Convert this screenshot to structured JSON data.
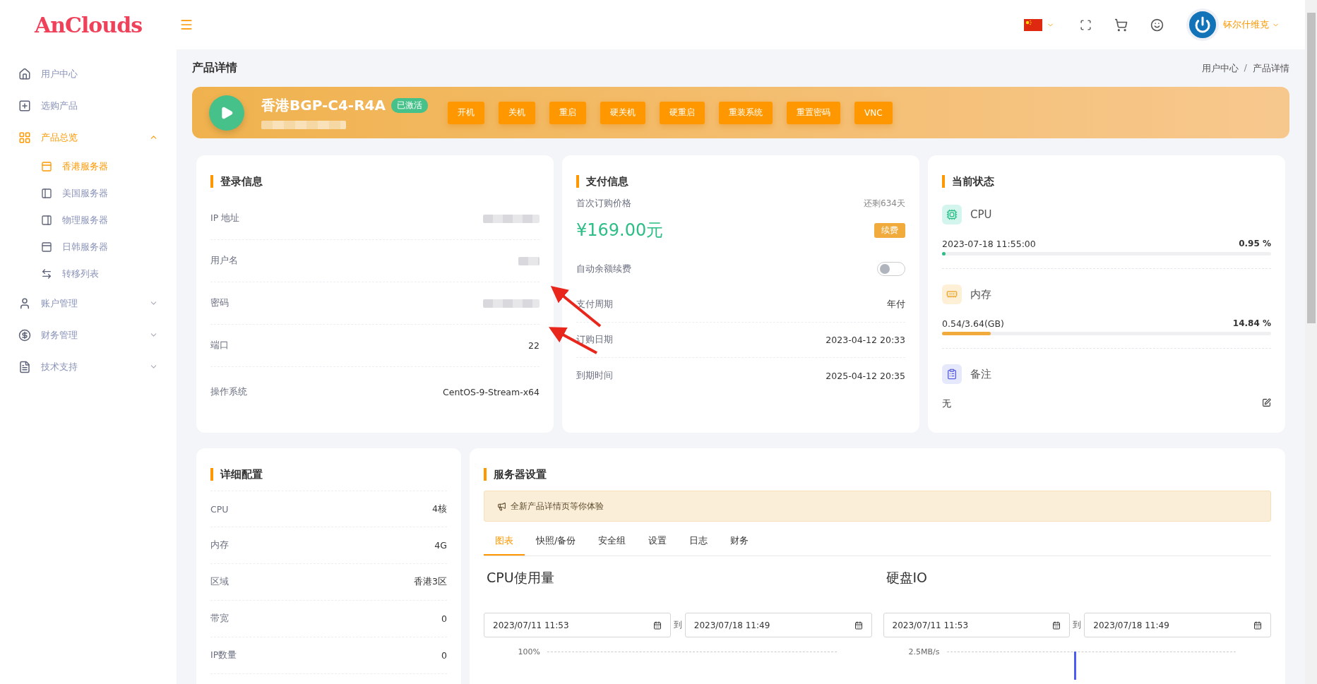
{
  "header": {
    "logo": "AnClouds",
    "user": "钚尔什维克"
  },
  "sidebar": {
    "items": [
      {
        "label": "用户中心",
        "selected": false
      },
      {
        "label": "选购产品",
        "selected": false
      },
      {
        "label": "产品总览",
        "selected": true,
        "expanded": true,
        "children": [
          {
            "label": "香港服务器",
            "selected": true
          },
          {
            "label": "美国服务器",
            "selected": false
          },
          {
            "label": "物理服务器",
            "selected": false
          },
          {
            "label": "日韩服务器",
            "selected": false
          },
          {
            "label": "转移列表",
            "selected": false
          }
        ]
      },
      {
        "label": "账户管理",
        "selected": false,
        "expanded": false
      },
      {
        "label": "财务管理",
        "selected": false,
        "expanded": false
      },
      {
        "label": "技术支持",
        "selected": false,
        "expanded": false
      }
    ]
  },
  "page": {
    "title": "产品详情",
    "breadcrumb": [
      "用户中心",
      "产品详情"
    ],
    "breadcrumb_separator": "/"
  },
  "banner": {
    "name": "香港BGP-C4-R4A",
    "status": "已激活",
    "actions": [
      "开机",
      "关机",
      "重启",
      "硬关机",
      "硬重启",
      "重装系统",
      "重置密码",
      "VNC"
    ]
  },
  "login_info": {
    "title": "登录信息",
    "rows": [
      {
        "label": "IP 地址",
        "kind": "redacted"
      },
      {
        "label": "用户名",
        "kind": "redacted"
      },
      {
        "label": "密码",
        "kind": "redacted"
      },
      {
        "label": "端口",
        "kind": "text",
        "value": "22"
      },
      {
        "label": "操作系统",
        "kind": "text",
        "value": "CentOS-9-Stream-x64"
      }
    ]
  },
  "payment": {
    "title": "支付信息",
    "price_label": "首次订购价格",
    "remaining": "还剩634天",
    "price": "¥169.00元",
    "renew": "续费",
    "auto_renew": {
      "label": "自动余额续费",
      "on": false
    },
    "rows": [
      {
        "label": "支付周期",
        "value": "年付"
      },
      {
        "label": "订购日期",
        "value": "2023-04-12 20:33"
      },
      {
        "label": "到期时间",
        "value": "2025-04-12 20:35"
      }
    ]
  },
  "status": {
    "title": "当前状态",
    "cpu": {
      "label": "CPU",
      "reading": "2023-07-18 11:55:00",
      "percent": "0.95 %",
      "level": 0.0095
    },
    "memory": {
      "label": "内存",
      "reading": "0.54/3.64(GB)",
      "percent": "14.84 %",
      "level": 0.1484
    },
    "note": {
      "label": "备注",
      "value": "无"
    }
  },
  "config": {
    "title": "详细配置",
    "rows": [
      {
        "label": "CPU",
        "value": "4核"
      },
      {
        "label": "内存",
        "value": "4G"
      },
      {
        "label": "区域",
        "value": "香港3区"
      },
      {
        "label": "带宽",
        "value": "0"
      },
      {
        "label": "IP数量",
        "value": "0"
      }
    ]
  },
  "server_settings": {
    "title": "服务器设置",
    "notice": "全新产品详情页等你体验",
    "tabs": [
      {
        "label": "图表",
        "selected": true
      },
      {
        "label": "快照/备份",
        "selected": false
      },
      {
        "label": "安全组",
        "selected": false
      },
      {
        "label": "设置",
        "selected": false
      },
      {
        "label": "日志",
        "selected": false
      },
      {
        "label": "财务",
        "selected": false
      }
    ],
    "panels": [
      {
        "title": "CPU使用量",
        "from": "2023/07/11 11:53",
        "separator": "到",
        "to": "2023/07/18 11:49",
        "top_tick": "100%"
      },
      {
        "title": "硬盘IO",
        "from": "2023/07/11 11:53",
        "separator": "到",
        "to": "2023/07/18 11:49",
        "top_tick": "2.5MB/s"
      }
    ]
  }
}
